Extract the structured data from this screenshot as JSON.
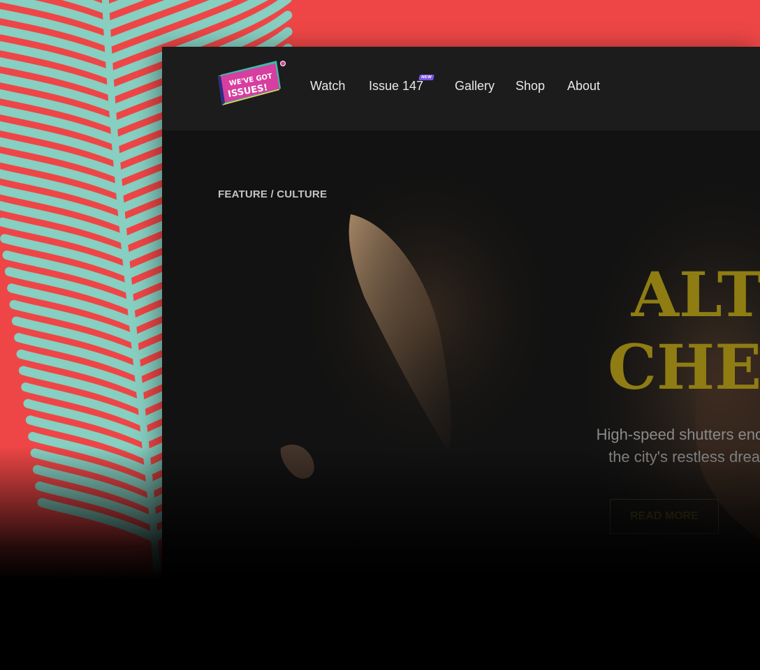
{
  "colors": {
    "backdrop": "#ee4646",
    "palm_leaf": "#86cfc1",
    "window_bg": "#111111",
    "navbar_bg": "#1c1c1c",
    "headline": "#8f7d14",
    "new_badge": "#7b55e6",
    "logo_magenta": "#d63ea0",
    "logo_yellow": "#f1e04a",
    "logo_teal": "#3fb8a8"
  },
  "logo": {
    "line1": "WE'VE GOT",
    "line2": "ISSUES!"
  },
  "nav": {
    "items": [
      {
        "label": "Watch"
      },
      {
        "label": "Issue 147",
        "badge": "NEW"
      },
      {
        "label": "Gallery"
      },
      {
        "label": "Shop"
      },
      {
        "label": "About"
      }
    ]
  },
  "hero": {
    "breadcrumb": "FEATURE / CULTURE",
    "headline_line1": "ALT–",
    "headline_line2": "CHEMY",
    "subtitle_line1": "High-speed shutters encounter",
    "subtitle_line2": "the city's restless dreamers",
    "cta_label": "READ MORE"
  },
  "icons": {
    "logo": "magazine-logo-icon",
    "palm": "palm-leaf-decoration"
  }
}
